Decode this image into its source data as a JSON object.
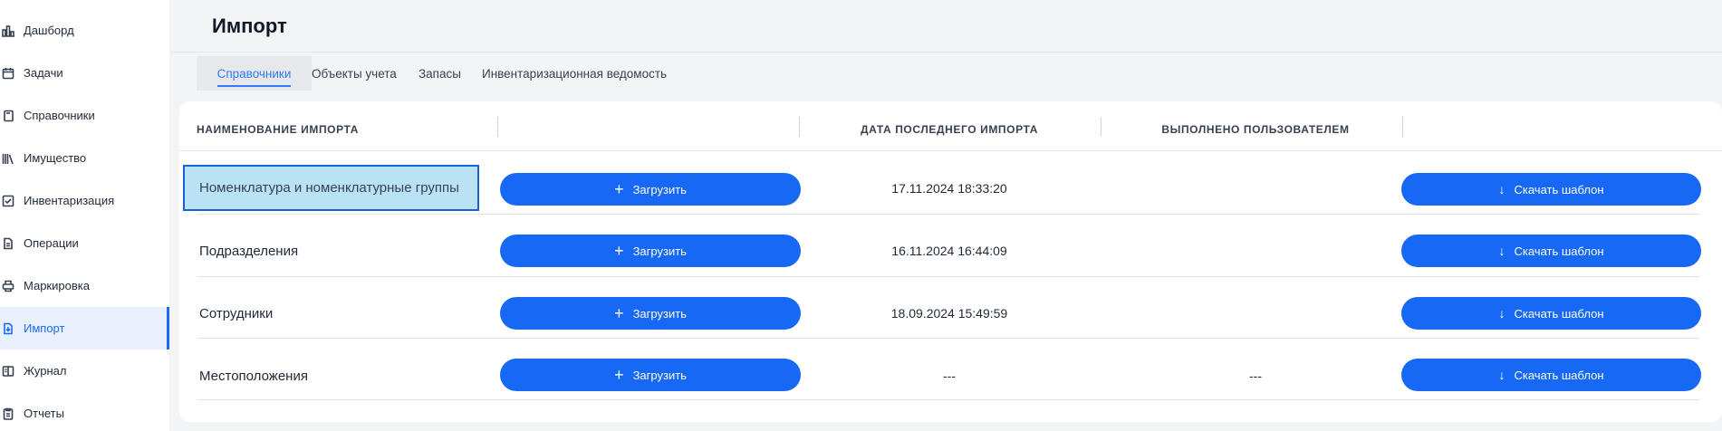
{
  "sidebar": {
    "items": [
      {
        "label": "Дашборд",
        "icon": "chart-bar-icon"
      },
      {
        "label": "Задачи",
        "icon": "calendar-icon"
      },
      {
        "label": "Справочники",
        "icon": "book-icon"
      },
      {
        "label": "Имущество",
        "icon": "library-icon"
      },
      {
        "label": "Инвентаризация",
        "icon": "checklist-icon"
      },
      {
        "label": "Операции",
        "icon": "document-icon"
      },
      {
        "label": "Маркировка",
        "icon": "printer-icon"
      },
      {
        "label": "Импорт",
        "icon": "file-import-icon"
      },
      {
        "label": "Журнал",
        "icon": "journal-icon"
      },
      {
        "label": "Отчеты",
        "icon": "clipboard-icon"
      }
    ],
    "active": "Импорт"
  },
  "header": {
    "title": "Импорт"
  },
  "tabs": [
    {
      "label": "Справочники",
      "active": true
    },
    {
      "label": "Объекты учета",
      "active": false
    },
    {
      "label": "Запасы",
      "active": false
    },
    {
      "label": "Инвентаризационная ведомость",
      "active": false
    }
  ],
  "table": {
    "columns": [
      "НАИМЕНОВАНИЕ ИМПОРТА",
      "",
      "ДАТА ПОСЛЕДНЕГО ИМПОРТА",
      "ВЫПОЛНЕНО ПОЛЬЗОВАТЕЛЕМ",
      ""
    ],
    "upload_label": "Загрузить",
    "download_label": "Скачать шаблон",
    "rows": [
      {
        "name": "Номенклатура и номенклатурные группы",
        "date": "17.11.2024 18:33:20",
        "user": "",
        "selected": true
      },
      {
        "name": "Подразделения",
        "date": "16.11.2024 16:44:09",
        "user": "",
        "selected": false
      },
      {
        "name": "Сотрудники",
        "date": "18.09.2024 15:49:59",
        "user": "",
        "selected": false
      },
      {
        "name": "Местоположения",
        "date": "---",
        "user": "---",
        "selected": false
      }
    ]
  },
  "colors": {
    "accent": "#1668f5",
    "active_bg": "#e8f0fe",
    "selected_row_bg": "#b9e3f4"
  }
}
